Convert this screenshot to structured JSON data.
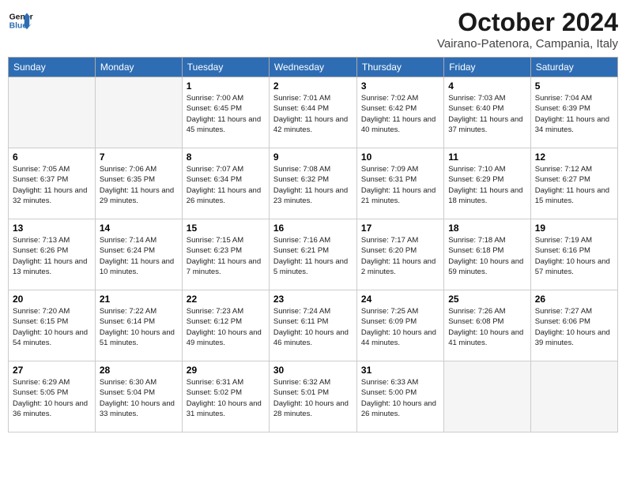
{
  "header": {
    "logo_line1": "General",
    "logo_line2": "Blue",
    "month": "October 2024",
    "location": "Vairano-Patenora, Campania, Italy"
  },
  "weekdays": [
    "Sunday",
    "Monday",
    "Tuesday",
    "Wednesday",
    "Thursday",
    "Friday",
    "Saturday"
  ],
  "weeks": [
    [
      {
        "day": "",
        "sunrise": "",
        "sunset": "",
        "daylight": ""
      },
      {
        "day": "",
        "sunrise": "",
        "sunset": "",
        "daylight": ""
      },
      {
        "day": "1",
        "sunrise": "Sunrise: 7:00 AM",
        "sunset": "Sunset: 6:45 PM",
        "daylight": "Daylight: 11 hours and 45 minutes."
      },
      {
        "day": "2",
        "sunrise": "Sunrise: 7:01 AM",
        "sunset": "Sunset: 6:44 PM",
        "daylight": "Daylight: 11 hours and 42 minutes."
      },
      {
        "day": "3",
        "sunrise": "Sunrise: 7:02 AM",
        "sunset": "Sunset: 6:42 PM",
        "daylight": "Daylight: 11 hours and 40 minutes."
      },
      {
        "day": "4",
        "sunrise": "Sunrise: 7:03 AM",
        "sunset": "Sunset: 6:40 PM",
        "daylight": "Daylight: 11 hours and 37 minutes."
      },
      {
        "day": "5",
        "sunrise": "Sunrise: 7:04 AM",
        "sunset": "Sunset: 6:39 PM",
        "daylight": "Daylight: 11 hours and 34 minutes."
      }
    ],
    [
      {
        "day": "6",
        "sunrise": "Sunrise: 7:05 AM",
        "sunset": "Sunset: 6:37 PM",
        "daylight": "Daylight: 11 hours and 32 minutes."
      },
      {
        "day": "7",
        "sunrise": "Sunrise: 7:06 AM",
        "sunset": "Sunset: 6:35 PM",
        "daylight": "Daylight: 11 hours and 29 minutes."
      },
      {
        "day": "8",
        "sunrise": "Sunrise: 7:07 AM",
        "sunset": "Sunset: 6:34 PM",
        "daylight": "Daylight: 11 hours and 26 minutes."
      },
      {
        "day": "9",
        "sunrise": "Sunrise: 7:08 AM",
        "sunset": "Sunset: 6:32 PM",
        "daylight": "Daylight: 11 hours and 23 minutes."
      },
      {
        "day": "10",
        "sunrise": "Sunrise: 7:09 AM",
        "sunset": "Sunset: 6:31 PM",
        "daylight": "Daylight: 11 hours and 21 minutes."
      },
      {
        "day": "11",
        "sunrise": "Sunrise: 7:10 AM",
        "sunset": "Sunset: 6:29 PM",
        "daylight": "Daylight: 11 hours and 18 minutes."
      },
      {
        "day": "12",
        "sunrise": "Sunrise: 7:12 AM",
        "sunset": "Sunset: 6:27 PM",
        "daylight": "Daylight: 11 hours and 15 minutes."
      }
    ],
    [
      {
        "day": "13",
        "sunrise": "Sunrise: 7:13 AM",
        "sunset": "Sunset: 6:26 PM",
        "daylight": "Daylight: 11 hours and 13 minutes."
      },
      {
        "day": "14",
        "sunrise": "Sunrise: 7:14 AM",
        "sunset": "Sunset: 6:24 PM",
        "daylight": "Daylight: 11 hours and 10 minutes."
      },
      {
        "day": "15",
        "sunrise": "Sunrise: 7:15 AM",
        "sunset": "Sunset: 6:23 PM",
        "daylight": "Daylight: 11 hours and 7 minutes."
      },
      {
        "day": "16",
        "sunrise": "Sunrise: 7:16 AM",
        "sunset": "Sunset: 6:21 PM",
        "daylight": "Daylight: 11 hours and 5 minutes."
      },
      {
        "day": "17",
        "sunrise": "Sunrise: 7:17 AM",
        "sunset": "Sunset: 6:20 PM",
        "daylight": "Daylight: 11 hours and 2 minutes."
      },
      {
        "day": "18",
        "sunrise": "Sunrise: 7:18 AM",
        "sunset": "Sunset: 6:18 PM",
        "daylight": "Daylight: 10 hours and 59 minutes."
      },
      {
        "day": "19",
        "sunrise": "Sunrise: 7:19 AM",
        "sunset": "Sunset: 6:16 PM",
        "daylight": "Daylight: 10 hours and 57 minutes."
      }
    ],
    [
      {
        "day": "20",
        "sunrise": "Sunrise: 7:20 AM",
        "sunset": "Sunset: 6:15 PM",
        "daylight": "Daylight: 10 hours and 54 minutes."
      },
      {
        "day": "21",
        "sunrise": "Sunrise: 7:22 AM",
        "sunset": "Sunset: 6:14 PM",
        "daylight": "Daylight: 10 hours and 51 minutes."
      },
      {
        "day": "22",
        "sunrise": "Sunrise: 7:23 AM",
        "sunset": "Sunset: 6:12 PM",
        "daylight": "Daylight: 10 hours and 49 minutes."
      },
      {
        "day": "23",
        "sunrise": "Sunrise: 7:24 AM",
        "sunset": "Sunset: 6:11 PM",
        "daylight": "Daylight: 10 hours and 46 minutes."
      },
      {
        "day": "24",
        "sunrise": "Sunrise: 7:25 AM",
        "sunset": "Sunset: 6:09 PM",
        "daylight": "Daylight: 10 hours and 44 minutes."
      },
      {
        "day": "25",
        "sunrise": "Sunrise: 7:26 AM",
        "sunset": "Sunset: 6:08 PM",
        "daylight": "Daylight: 10 hours and 41 minutes."
      },
      {
        "day": "26",
        "sunrise": "Sunrise: 7:27 AM",
        "sunset": "Sunset: 6:06 PM",
        "daylight": "Daylight: 10 hours and 39 minutes."
      }
    ],
    [
      {
        "day": "27",
        "sunrise": "Sunrise: 6:29 AM",
        "sunset": "Sunset: 5:05 PM",
        "daylight": "Daylight: 10 hours and 36 minutes."
      },
      {
        "day": "28",
        "sunrise": "Sunrise: 6:30 AM",
        "sunset": "Sunset: 5:04 PM",
        "daylight": "Daylight: 10 hours and 33 minutes."
      },
      {
        "day": "29",
        "sunrise": "Sunrise: 6:31 AM",
        "sunset": "Sunset: 5:02 PM",
        "daylight": "Daylight: 10 hours and 31 minutes."
      },
      {
        "day": "30",
        "sunrise": "Sunrise: 6:32 AM",
        "sunset": "Sunset: 5:01 PM",
        "daylight": "Daylight: 10 hours and 28 minutes."
      },
      {
        "day": "31",
        "sunrise": "Sunrise: 6:33 AM",
        "sunset": "Sunset: 5:00 PM",
        "daylight": "Daylight: 10 hours and 26 minutes."
      },
      {
        "day": "",
        "sunrise": "",
        "sunset": "",
        "daylight": ""
      },
      {
        "day": "",
        "sunrise": "",
        "sunset": "",
        "daylight": ""
      }
    ]
  ]
}
